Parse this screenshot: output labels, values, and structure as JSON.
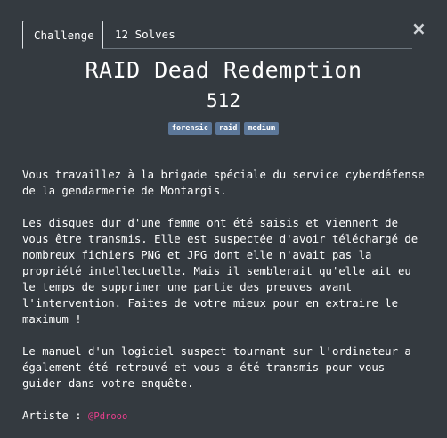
{
  "tabs": {
    "challenge_label": "Challenge",
    "solves_label": "12 Solves"
  },
  "close_symbol": "×",
  "challenge": {
    "title": "RAID Dead Redemption",
    "points": "512",
    "tags": [
      "forensic",
      "raid",
      "medium"
    ],
    "description": [
      "Vous travaillez à la brigade spéciale du service cyberdéfense de la gendarmerie de Montargis.",
      "Les disques dur d'une femme ont été saisis et viennent de vous être transmis. Elle est suspectée d'avoir téléchargé de nombreux fichiers PNG et JPG dont elle n'avait pas la propriété intellectuelle. Mais il semblerait qu'elle ait eu le temps de supprimer une partie des preuves avant l'intervention. Faites de votre mieux pour en extraire le maximum !",
      "Le manuel d'un logiciel suspect tournant sur l'ordinateur a également été retrouvé et vous a été transmis pour vous guider dans votre enquête."
    ],
    "artist_label": "Artiste : ",
    "artist_handle": "@Pdrooo"
  },
  "colors": {
    "background": "#343a40",
    "tag_background": "#5c7799",
    "artist_link": "#e83e8c"
  }
}
